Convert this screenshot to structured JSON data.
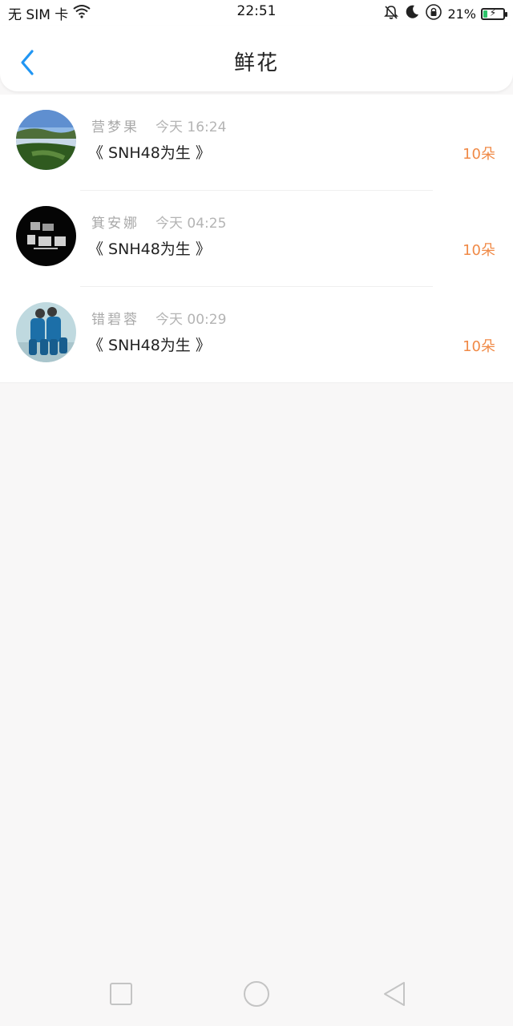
{
  "status_bar": {
    "carrier": "无 SIM 卡",
    "time": "22:51",
    "battery_percent": "21%",
    "battery_level": 0.21,
    "icons": [
      "wifi-icon",
      "bell-muted-icon",
      "moon-icon",
      "rotation-lock-icon",
      "battery-icon"
    ]
  },
  "header": {
    "title": "鲜花",
    "back_icon": "chevron-left-icon",
    "accent_color": "#2196f3"
  },
  "list": {
    "items": [
      {
        "name": "营梦果",
        "time": "今天 16:24",
        "content": "《 SNH48为生 》",
        "count": "10朵",
        "avatar": "landscape-avatar"
      },
      {
        "name": "箕安娜",
        "time": "今天 04:25",
        "content": "《 SNH48为生 》",
        "count": "10朵",
        "avatar": "text-art-avatar"
      },
      {
        "name": "错碧蓉",
        "time": "今天 00:29",
        "content": "《 SNH48为生 》",
        "count": "10朵",
        "avatar": "kids-avatar"
      }
    ],
    "count_color": "#f08a47"
  },
  "nav_bar": {
    "icons": [
      "square-icon",
      "circle-icon",
      "triangle-back-icon"
    ]
  }
}
